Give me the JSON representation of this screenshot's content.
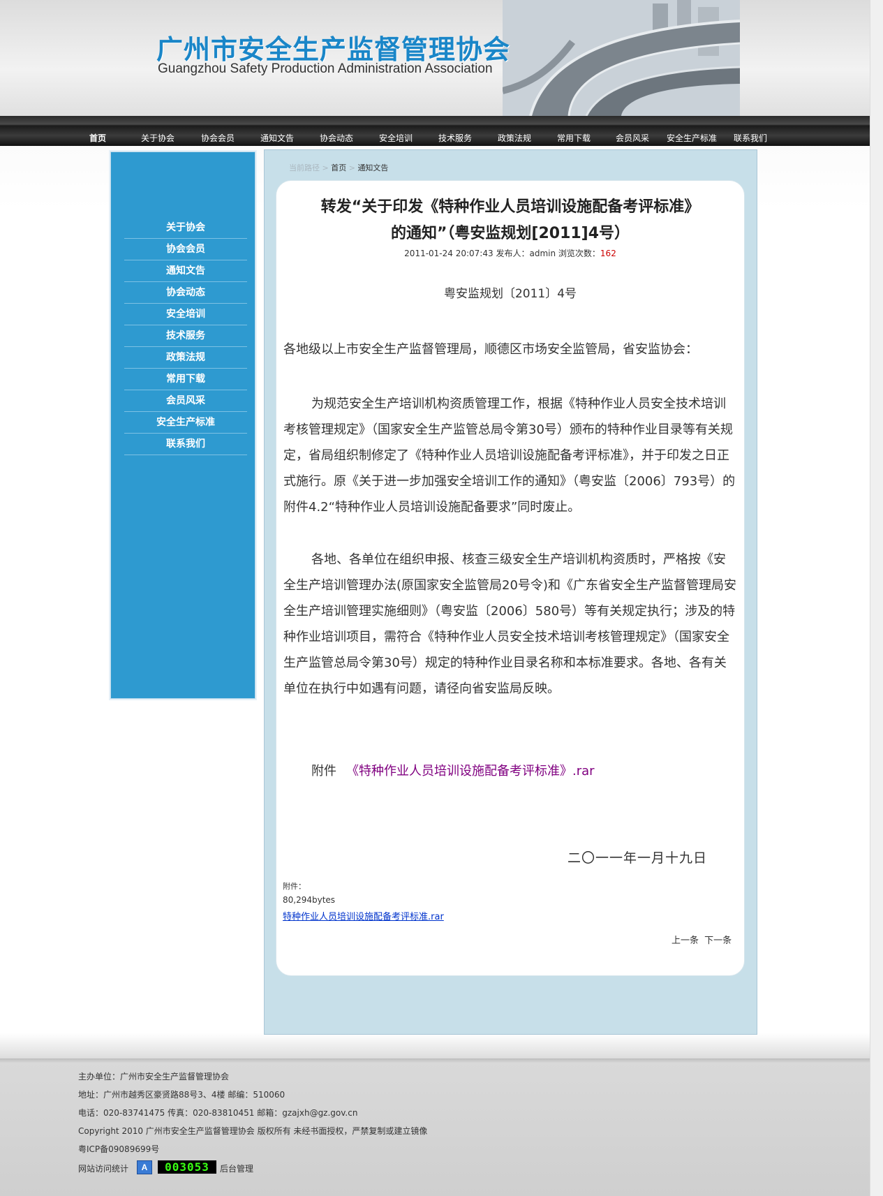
{
  "header": {
    "title_cn": "广州市安全生产监督管理协会",
    "title_en": "Guangzhou Safety Production Administration Association"
  },
  "nav": {
    "items": [
      "首页",
      "关于协会",
      "协会会员",
      "通知文告",
      "协会动态",
      "安全培训",
      "技术服务",
      "政策法规",
      "常用下载",
      "会员风采",
      "安全生产标准",
      "联系我们"
    ],
    "active": "首页"
  },
  "sidebar": {
    "items": [
      "关于协会",
      "协会会员",
      "通知文告",
      "协会动态",
      "安全培训",
      "技术服务",
      "政策法规",
      "常用下载",
      "会员风采",
      "安全生产标准",
      "联系我们"
    ]
  },
  "breadcrumb": {
    "label": "当前路径",
    "sep1": ">",
    "home": "首页",
    "sep2": ">",
    "current": "通知文告"
  },
  "article": {
    "title_line1": "转发“关于印发《特种作业人员培训设施配备考评标准》",
    "title_line2": "的通知”（粤安监规划[2011]4号）",
    "date": "2011-01-24 20:07:43",
    "publisher_label": "发布人：",
    "publisher": "admin",
    "views_label": "浏览次数：",
    "views": "162",
    "doc_number": "粤安监规划〔2011〕4号",
    "para1": "各地级以上市安全生产监督管理局，顺德区市场安全监管局，省安监协会：",
    "para2": "为规范安全生产培训机构资质管理工作，根据《特种作业人员安全技术培训考核管理规定》（国家安全生产监管总局令第30号）颁布的特种作业目录等有关规定，省局组织制修定了《特种作业人员培训设施配备考评标准》，并于印发之日正式施行。原《关于进一步加强安全培训工作的通知》（粤安监〔2006〕793号）的附件4.2“特种作业人员培训设施配备要求”同时废止。",
    "para3": "各地、各单位在组织申报、核查三级安全生产培训机构资质时，严格按《安全生产培训管理办法(原国家安全监管局20号令)和《广东省安全生产监督管理局安全生产培训管理实施细则》（粤安监〔2006〕580号）等有关规定执行；涉及的特种作业培训项目，需符合《特种作业人员安全技术培训考核管理规定》（国家安全生产监管总局令第30号）规定的特种作业目录名称和本标准要求。各地、各有关单位在执行中如遇有问题，请径向省安监局反映。",
    "attachment_prefix": "附件",
    "attachment_link": "《特种作业人员培训设施配备考评标准》.rar",
    "sign_date": "二〇一一年一月十九日",
    "files_label": "附件：",
    "file_size": "80,294bytes",
    "file_name": "特种作业人员培训设施配备考评标准.rar",
    "prev": "上一条",
    "next": "下一条"
  },
  "footer": {
    "host": "主办单位：广州市安全生产监督管理协会",
    "address": "地址：广州市越秀区豪贤路88号3、4楼 邮编：510060",
    "contact": "电话：020-83741475 传真：020-83810451 邮箱：gzajxh@gz.gov.cn",
    "copyright": "Copyright 2010 广州市安全生产监督管理协会 版权所有 未经书面授权，严禁复制或建立镜像",
    "icp": "粤ICP备09089699号",
    "stats_label": "网站访问统计",
    "stats_icon": "A",
    "counter": "003053",
    "admin": "后台管理"
  }
}
